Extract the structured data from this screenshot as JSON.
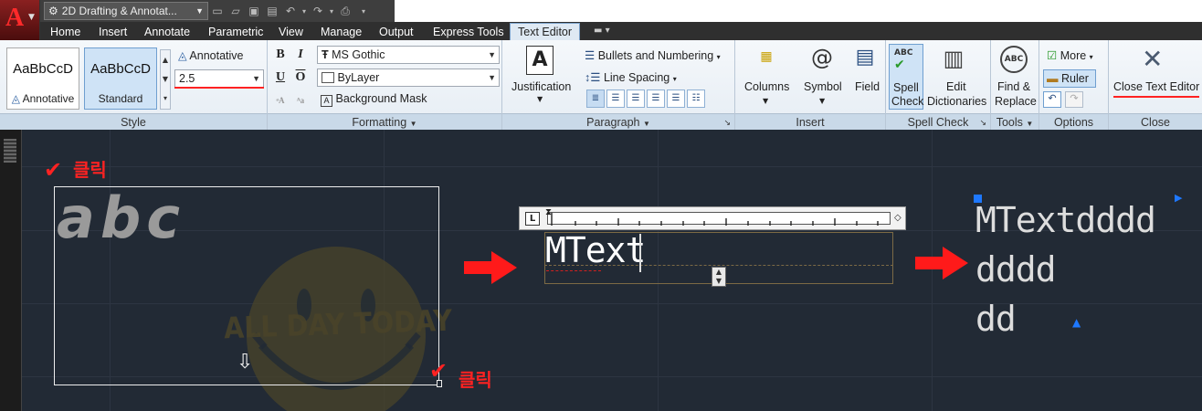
{
  "app": {
    "logo": "A",
    "workspace": "2D Drafting & Annotat..."
  },
  "tabs": [
    "Home",
    "Insert",
    "Annotate",
    "Parametric",
    "View",
    "Manage",
    "Output",
    "Express Tools",
    "Text Editor"
  ],
  "active_tab": "Text Editor",
  "ribbon": {
    "style": {
      "title": "Style",
      "styles": [
        {
          "sample": "AaBbCcD",
          "name": "Annotative"
        },
        {
          "sample": "AaBbCcD",
          "name": "Standard"
        }
      ],
      "annotative_label": "Annotative",
      "text_height": "2.5"
    },
    "formatting": {
      "title": "Formatting",
      "bold": "B",
      "italic": "I",
      "underline": "U",
      "overline": "O",
      "font": "MS Gothic",
      "color": "ByLayer",
      "background_mask": "Background Mask"
    },
    "paragraph": {
      "title": "Paragraph",
      "justification": "Justification",
      "bullets": "Bullets and Numbering",
      "line_spacing": "Line Spacing"
    },
    "insert": {
      "title": "Insert",
      "columns": "Columns",
      "symbol": "Symbol",
      "field": "Field"
    },
    "spell_check": {
      "title": "Spell Check",
      "spell_check_line1": "Spell",
      "spell_check_line2": "Check",
      "edit_dict_line1": "Edit",
      "edit_dict_line2": "Dictionaries"
    },
    "tools": {
      "title": "Tools",
      "find_line1": "Find &",
      "find_line2": "Replace"
    },
    "options": {
      "title": "Options",
      "more": "More",
      "ruler": "Ruler"
    },
    "close": {
      "title": "Close",
      "close_text_editor": "Close Text Editor"
    }
  },
  "canvas": {
    "handwriting": "abc",
    "click_label_1": "클릭",
    "click_label_2": "클릭",
    "watermark": "ALL DAY TODAY",
    "editing_text": "MText",
    "result_lines": [
      "MTextdddd",
      "dddd",
      "dd"
    ]
  },
  "colors": {
    "accent_red": "#ff2222",
    "grip_blue": "#1e78ff",
    "canvas_bg": "#222a35"
  }
}
